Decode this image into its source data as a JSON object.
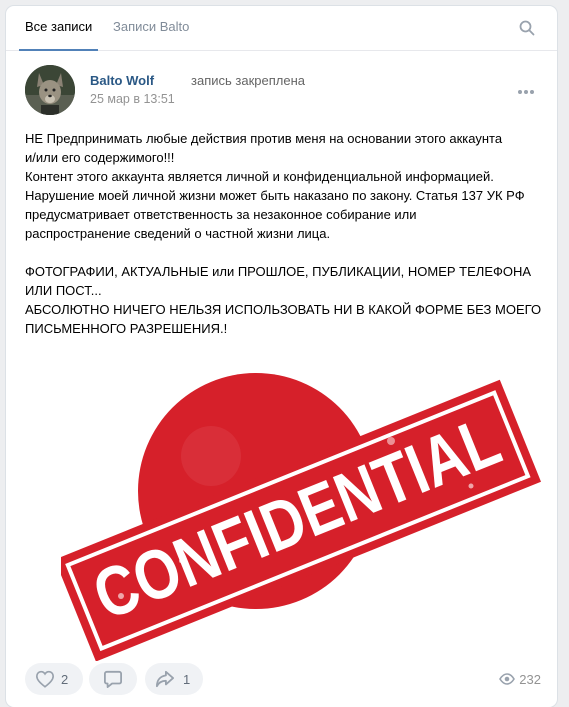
{
  "tabs": [
    {
      "label": "Все записи"
    },
    {
      "label": "Записи Balto"
    }
  ],
  "post": {
    "author": "Balto Wolf",
    "pinned_note": "запись закреплена",
    "date": "25 мар в 13:51",
    "text": "НЕ Предпринимать любые действия против меня на основании этого аккаунта\nи/или его содержимого!!!\nКонтент этого аккаунта является личной и конфиденциальной информацией.\nНарушение моей личной жизни может быть наказано по закону. Статья 137 УК РФ\nпредусматривает ответственность за незаконное собирание или\nраспространение сведений о частной жизни лица.\n\nФОТОГРАФИИ, АКТУАЛЬНЫЕ или ПРОШЛОЕ, ПУБЛИКАЦИИ, НОМЕР ТЕЛЕФОНА\nИЛИ ПОСТ...\nАБСОЛЮТНО НИЧЕГО НЕЛЬЗЯ ИСПОЛЬЗОВАТЬ НИ В КАКОЙ ФОРМЕ БЕЗ МОЕГО\nПИСЬМЕННОГО РАЗРЕШЕНИЯ.!",
    "image_word": "CONFIDENTIAL",
    "stamp_color": "#d6202a"
  },
  "actions": {
    "likes": "2",
    "shares": "1",
    "views": "232"
  },
  "colors": {
    "link": "#2a5885",
    "accent": "#5181b8"
  }
}
